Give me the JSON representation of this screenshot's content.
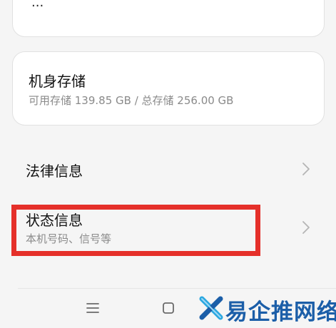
{
  "top_card": {
    "fragment": "..."
  },
  "storage": {
    "title": "机身存储",
    "subtitle": "可用存储 139.85 GB / 总存储 256.00 GB"
  },
  "legal": {
    "title": "法律信息"
  },
  "status": {
    "title": "状态信息",
    "subtitle": "本机号码、信号等"
  },
  "highlight_color": "#e5302a",
  "nav": {
    "menu_icon": "menu-icon",
    "home_icon": "home-square-icon",
    "back_icon": "back-icon"
  },
  "watermark": {
    "text": "易企推网络",
    "logo": "x-logo-icon",
    "color": "#1b5ea8"
  }
}
